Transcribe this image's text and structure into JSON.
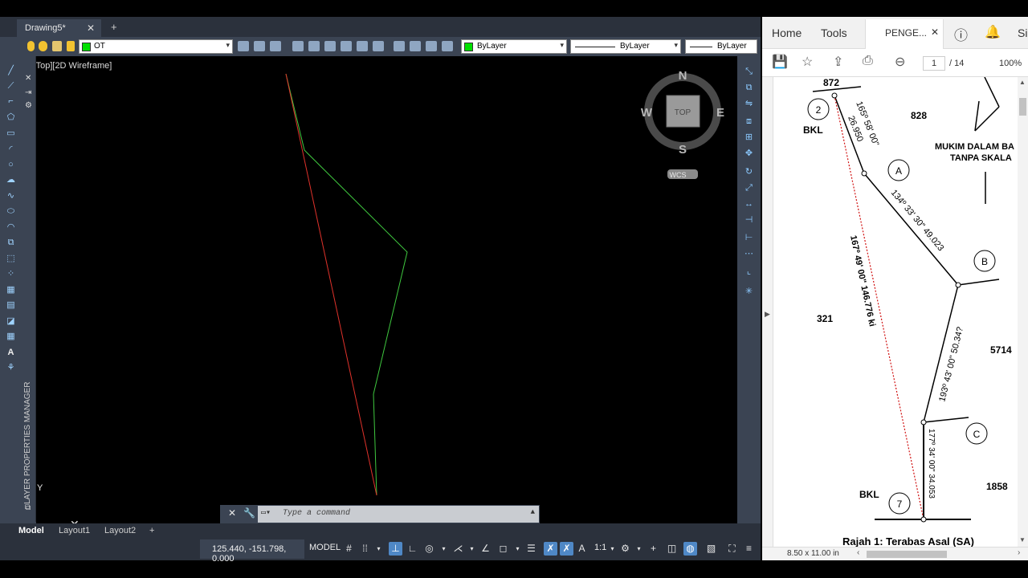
{
  "autocad": {
    "doc_tab": "Drawing5*",
    "doc_tab_close": "✕",
    "new_tab": "+",
    "layer_name": "OT",
    "color_prop": "ByLayer",
    "linetype_prop": "ByLayer",
    "lineweight_prop": "ByLayer",
    "viewport_label": "[−][Top][2D Wireframe]",
    "palette_label": "LAYER PROPERTIES MANAGER",
    "viewcube": {
      "north": "N",
      "south": "S",
      "east": "E",
      "west": "W",
      "top": "TOP",
      "wcs": "WCS"
    },
    "ucs_y": "Y",
    "command_placeholder": "Type a command",
    "layout_tabs": [
      "Model",
      "Layout1",
      "Layout2"
    ],
    "layout_add": "+",
    "coordinates": "125.440, -151.798, 0.000",
    "model_label": "MODEL",
    "scale": "1:1",
    "colors": {
      "green_line": "#3fc83f",
      "red_line": "#e0322b",
      "layer_swatch": "#00e000"
    }
  },
  "acrobat": {
    "menu": {
      "home": "Home",
      "tools": "Tools",
      "user": "Si"
    },
    "doc_tab": "PENGE...",
    "doc_tab_close": "✕",
    "page_current": "1",
    "page_total": "/ 14",
    "zoom": "100%",
    "page_size": "8.50 x 11.00 in",
    "plan": {
      "lot_872": "872",
      "lot_828": "828",
      "lot_321": "321",
      "lot_5714": "5714",
      "lot_1858": "1858",
      "bkl_top": "BKL",
      "bkl_bottom": "BKL",
      "stn_2": "2",
      "stn_a": "A",
      "stn_b": "B",
      "stn_c": "C",
      "stn_7": "7",
      "brg_2a": "165º 58' 00\"",
      "dist_2a": "26.950",
      "brg_ab": "134º 33' 30\"  49.023",
      "brg_bc": "193º 43' 00\"  50.34?",
      "brg_c7": "177º 34' 00\"  34.053",
      "brg_27": "167º 49' 00\"  146.776 ki",
      "note_1": "MUKIM DALAM BA",
      "note_2": "TANPA SKALA",
      "caption": "Rajah 1: Terabas Asal (SA)"
    }
  }
}
